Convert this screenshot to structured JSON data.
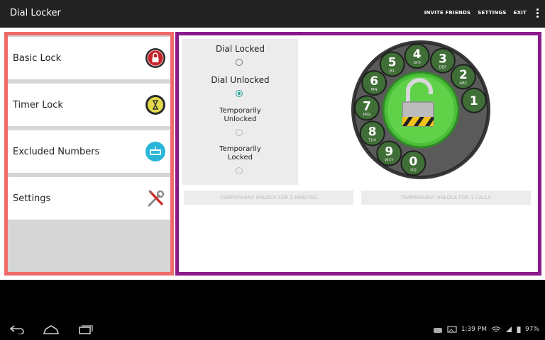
{
  "app": {
    "title": "Dial Locker"
  },
  "actions": [
    "INVITE FRIENDS",
    "SETTINGS",
    "EXIT"
  ],
  "menu": [
    {
      "label": "Basic Lock",
      "icon": "lock-icon"
    },
    {
      "label": "Timer Lock",
      "icon": "timer-icon"
    },
    {
      "label": "Excluded Numbers",
      "icon": "excluded-numbers-icon"
    },
    {
      "label": "Settings",
      "icon": "tools-icon"
    }
  ],
  "options": {
    "dial_locked": "Dial Locked",
    "dial_unlocked": "Dial Unlocked",
    "temp_unlocked_1": "Temporarily",
    "temp_unlocked_2": "Unlocked",
    "temp_locked_1": "Temporarily",
    "temp_locked_2": "Locked",
    "selected": "Dial Unlocked"
  },
  "dial_keys": [
    {
      "num": "1",
      "letters": ""
    },
    {
      "num": "2",
      "letters": "ABC"
    },
    {
      "num": "3",
      "letters": "DEF"
    },
    {
      "num": "4",
      "letters": "GHI"
    },
    {
      "num": "5",
      "letters": "JKL"
    },
    {
      "num": "6",
      "letters": "MN"
    },
    {
      "num": "7",
      "letters": "PRS"
    },
    {
      "num": "8",
      "letters": "TUV"
    },
    {
      "num": "9",
      "letters": "WXY"
    },
    {
      "num": "0",
      "letters": "OQ"
    }
  ],
  "buttons": {
    "unlock_minutes": "TEMPORARILY UNLOCK FOR 3 MINUTES",
    "unlock_calls": "TEMPORARILY UNLOCK FOR 1 CALLS"
  },
  "status": {
    "time": "1:39 PM",
    "battery": "97%"
  },
  "colors": {
    "left_border": "#f06a6a",
    "right_border": "#8a1a8a",
    "accent": "#1aa79a",
    "dial_green": "#4cbf3a"
  }
}
